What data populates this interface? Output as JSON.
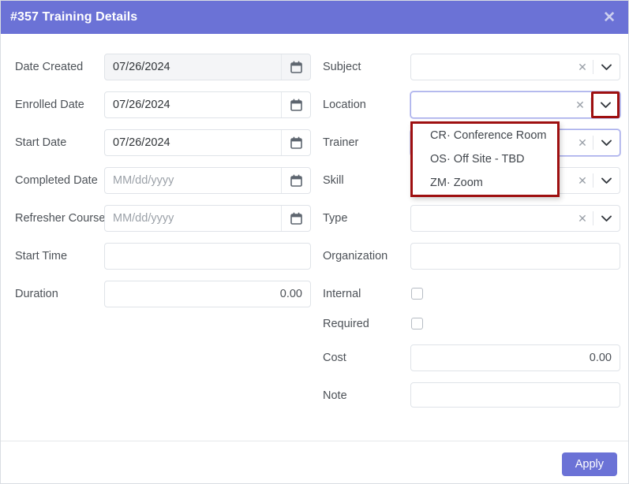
{
  "window": {
    "title": "#357 Training Details",
    "close_icon": "close-icon",
    "close_glyph": "✕"
  },
  "left_column": {
    "fields": [
      {
        "label": "Date Created",
        "value": "07/26/2024",
        "placeholder": "",
        "readonly": true,
        "kind": "date",
        "icon": "calendar-icon"
      },
      {
        "label": "Enrolled Date",
        "value": "07/26/2024",
        "placeholder": "",
        "readonly": false,
        "kind": "date",
        "icon": "calendar-icon"
      },
      {
        "label": "Start Date",
        "value": "07/26/2024",
        "placeholder": "",
        "readonly": false,
        "kind": "date",
        "icon": "calendar-icon"
      },
      {
        "label": "Completed Date",
        "value": "",
        "placeholder": "MM/dd/yyyy",
        "readonly": false,
        "kind": "date",
        "icon": "calendar-icon"
      },
      {
        "label": "Refresher Course",
        "value": "",
        "placeholder": "MM/dd/yyyy",
        "readonly": false,
        "kind": "date",
        "icon": "calendar-icon"
      },
      {
        "label": "Start Time",
        "value": "",
        "placeholder": "",
        "readonly": false,
        "kind": "text",
        "icon": ""
      },
      {
        "label": "Duration",
        "value": "0.00",
        "placeholder": "",
        "readonly": false,
        "kind": "number",
        "icon": ""
      }
    ]
  },
  "right_column": {
    "fields": [
      {
        "label": "Subject",
        "value": "",
        "kind": "select",
        "clear_icon": "clear-icon",
        "chevron_icon": "chevron-down-icon",
        "focused": false,
        "highlighted": false
      },
      {
        "label": "Location",
        "value": "",
        "kind": "select",
        "clear_icon": "clear-icon",
        "chevron_icon": "chevron-down-icon",
        "focused": true,
        "highlighted": true
      },
      {
        "label": "Trainer",
        "value": "",
        "kind": "select",
        "clear_icon": "clear-icon",
        "chevron_icon": "chevron-down-icon",
        "focused": false,
        "highlighted": false
      },
      {
        "label": "Skill",
        "value": "",
        "kind": "select",
        "clear_icon": "clear-icon",
        "chevron_icon": "chevron-down-icon",
        "focused": false,
        "highlighted": false
      },
      {
        "label": "Type",
        "value": "",
        "kind": "select",
        "clear_icon": "clear-icon",
        "chevron_icon": "chevron-down-icon",
        "focused": false,
        "highlighted": false
      },
      {
        "label": "Organization",
        "value": "",
        "kind": "text",
        "clear_icon": "",
        "chevron_icon": "",
        "focused": false,
        "highlighted": false
      },
      {
        "label": "Internal",
        "value": "",
        "kind": "checkbox",
        "checked": false
      },
      {
        "label": "Required",
        "value": "",
        "kind": "checkbox",
        "checked": false
      },
      {
        "label": "Cost",
        "value": "0.00",
        "kind": "number",
        "clear_icon": "",
        "chevron_icon": "",
        "focused": false,
        "highlighted": false
      },
      {
        "label": "Note",
        "value": "",
        "kind": "text",
        "clear_icon": "",
        "chevron_icon": "",
        "focused": false,
        "highlighted": false
      }
    ]
  },
  "location_dropdown": {
    "open": true,
    "options": [
      "CR· Conference Room",
      "OS· Off Site - TBD",
      "ZM· Zoom"
    ]
  },
  "footer": {
    "apply_label": "Apply"
  },
  "colors": {
    "header_purple": "#6b72d6",
    "highlight_red": "#9e0f10",
    "focus_border": "#a6aced",
    "label_text": "#4c5157",
    "field_border": "#dfe3e8",
    "readonly_bg": "#f4f5f7"
  }
}
